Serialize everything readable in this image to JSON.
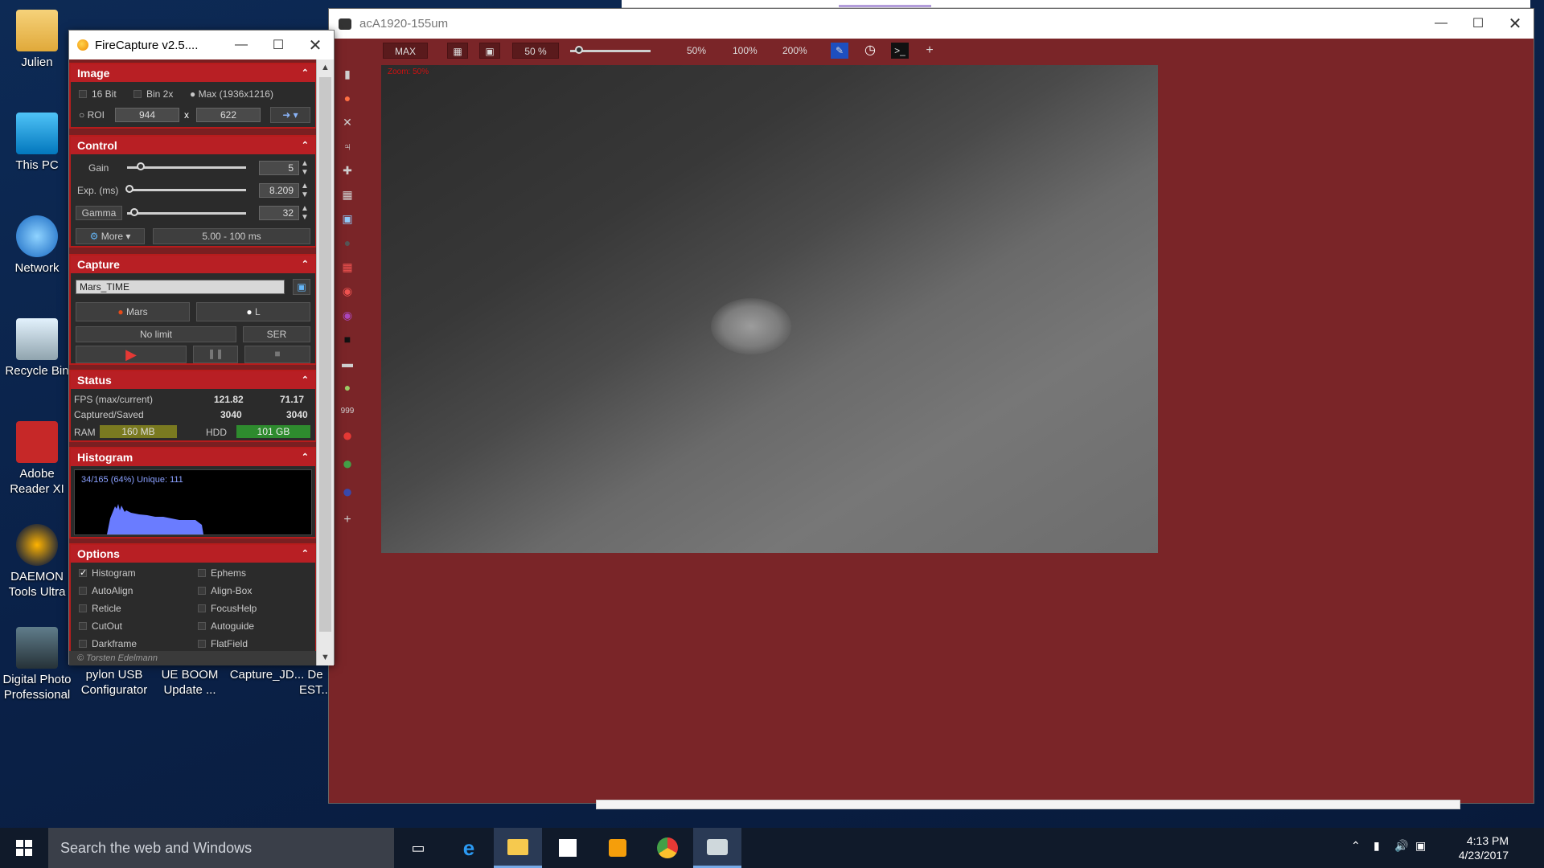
{
  "desktop": {
    "icons": [
      {
        "label": "Julien"
      },
      {
        "label": "This PC"
      },
      {
        "label": "Network"
      },
      {
        "label": "Recycle Bin"
      },
      {
        "label": "Adobe Reader XI"
      },
      {
        "label": "DAEMON Tools Ultra"
      },
      {
        "label": "Digital Photo Professional"
      },
      {
        "label": "pylon USB Configurator"
      },
      {
        "label": "UE BOOM Update ..."
      },
      {
        "label": "Capture_JD..."
      },
      {
        "label": "De EST..."
      }
    ]
  },
  "firecapture": {
    "title": "FireCapture v2.5....",
    "footer": "© Torsten Edelmann",
    "image": {
      "header": "Image",
      "bit16": "16 Bit",
      "bin2x": "Bin 2x",
      "max": "Max (1936x1216)",
      "roi": "ROI",
      "roi_w": "944",
      "roi_x": "x",
      "roi_h": "622"
    },
    "control": {
      "header": "Control",
      "gain_label": "Gain",
      "gain_value": "5",
      "exp_label": "Exp. (ms)",
      "exp_value": "8.209",
      "gamma_label": "Gamma",
      "gamma_value": "32",
      "more": "More",
      "range": "5.00 - 100 ms"
    },
    "capture": {
      "header": "Capture",
      "filename": "Mars_TIME",
      "object": "Mars",
      "filter": "L",
      "limit": "No limit",
      "format": "SER"
    },
    "status": {
      "header": "Status",
      "fps_label": "FPS (max/current)",
      "fps_max": "121.82",
      "fps_current": "71.17",
      "cap_label": "Captured/Saved",
      "captured": "3040",
      "saved": "3040",
      "ram_label": "RAM",
      "ram_value": "160 MB",
      "hdd_label": "HDD",
      "hdd_value": "101 GB"
    },
    "histogram": {
      "header": "Histogram",
      "info": "34/165 (64%)  Unique: 111"
    },
    "options": {
      "header": "Options",
      "items_left": [
        "Histogram",
        "AutoAlign",
        "Reticle",
        "CutOut",
        "Darkframe"
      ],
      "items_right": [
        "Ephems",
        "Align-Box",
        "FocusHelp",
        "Autoguide",
        "FlatField"
      ]
    }
  },
  "camera": {
    "title": "acA1920-155um",
    "toolbar": {
      "max": "MAX",
      "zoom": "50 %",
      "z50": "50%",
      "z100": "100%",
      "z200": "200%",
      "plus": "+"
    },
    "zoom_overlay": "Zoom: 50%"
  },
  "taskbar": {
    "search_placeholder": "Search the web and Windows",
    "time": "4:13 PM",
    "date": "4/23/2017"
  },
  "colors": {
    "panel_red": "#b81f24",
    "window_bg": "#7a2528",
    "ram_bar": "#7a7a20",
    "hdd_bar": "#2e8b2e",
    "histogram_fill": "#6a7cff"
  }
}
